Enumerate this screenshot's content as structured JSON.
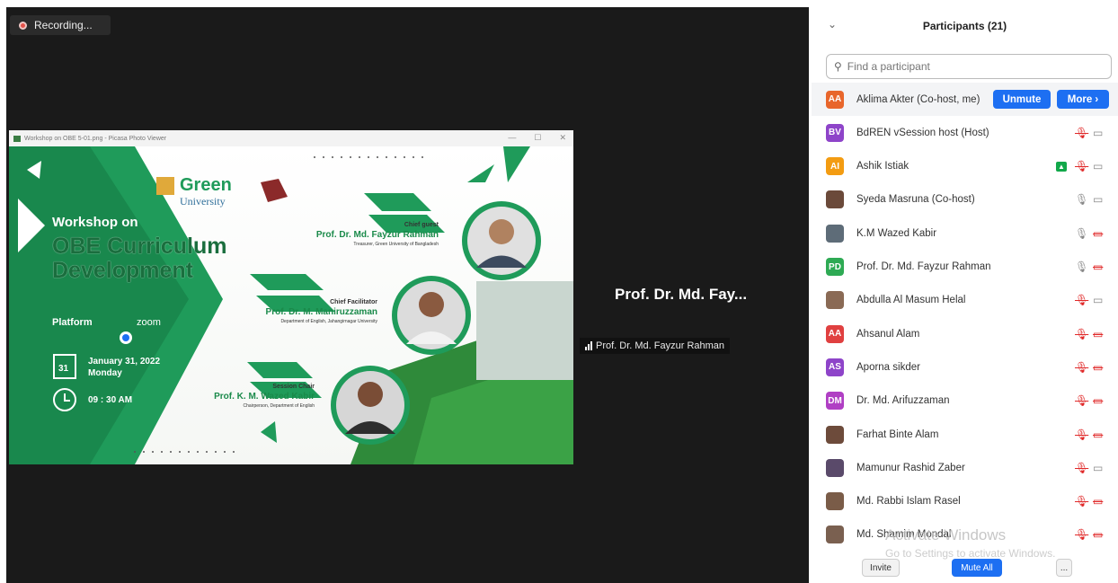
{
  "meeting": {
    "recording_label": "Recording...",
    "active_speaker_name": "Prof. Dr. Md. Fay...",
    "active_speaker_tag": "Prof. Dr. Md. Fayzur Rahman"
  },
  "share_window": {
    "title": "Workshop on OBE 5-01.png - Picasa Photo Viewer",
    "poster": {
      "university_name_1": "Green",
      "university_name_2": "University",
      "workshop_on": "Workshop on",
      "title_line1": "OBE Curriculum",
      "title_line2": "Development",
      "platform_label": "Platform",
      "platform_name": "zoom",
      "date_day": "31",
      "date_text": "January 31, 2022",
      "weekday": "Monday",
      "time": "09 : 30 AM",
      "chief_guest_label": "Chief guest",
      "chief_guest_name": "Prof. Dr. Md. Fayzur Rahman",
      "chief_guest_role": "Treasurer, Green University of Bangladesh",
      "facilitator_label": "Chief Facilitator",
      "facilitator_name": "Prof. Dr. M. Maniruzzaman",
      "facilitator_role": "Department of English, Jahangirnagar University",
      "chair_label": "Session Chair",
      "chair_name": "Prof. K. M. Wazed Kabir",
      "chair_role": "Chairperson, Department of English"
    }
  },
  "participants_panel": {
    "title": "Participants (21)",
    "search_placeholder": "Find a participant",
    "unmute_label": "Unmute",
    "more_label": "More ›",
    "items": [
      {
        "initials": "AA",
        "color": "#e8662b",
        "name": "Aklima Akter (Co-host, me)",
        "mic": "",
        "video": ""
      },
      {
        "initials": "BV",
        "color": "#8e44c9",
        "name": "BdREN vSession host (Host)",
        "mic": "off",
        "video": "on"
      },
      {
        "initials": "AI",
        "color": "#f39c12",
        "name": "Ashik Istiak",
        "mic": "off",
        "video": "on",
        "sharing": true
      },
      {
        "initials": "",
        "color": "#6b4a3a",
        "name": "Syeda Masruna (Co-host)",
        "mic": "on",
        "video": "on",
        "photo": true
      },
      {
        "initials": "",
        "color": "#5e6c78",
        "name": "K.M Wazed Kabir",
        "mic": "on",
        "video": "off",
        "photo": true
      },
      {
        "initials": "PD",
        "color": "#2eaa54",
        "name": "Prof. Dr. Md. Fayzur Rahman",
        "mic": "on",
        "video": "off"
      },
      {
        "initials": "",
        "color": "#8a6a55",
        "name": "Abdulla Al Masum Helal",
        "mic": "off",
        "video": "on",
        "photo": true
      },
      {
        "initials": "AA",
        "color": "#e04040",
        "name": "Ahsanul Alam",
        "mic": "off",
        "video": "off"
      },
      {
        "initials": "AS",
        "color": "#8e44c9",
        "name": "Aporna sikder",
        "mic": "off",
        "video": "off"
      },
      {
        "initials": "DM",
        "color": "#b03fc4",
        "name": "Dr. Md. Arifuzzaman",
        "mic": "off",
        "video": "off"
      },
      {
        "initials": "",
        "color": "#6d4b3b",
        "name": "Farhat Binte Alam",
        "mic": "off",
        "video": "off",
        "photo": true
      },
      {
        "initials": "",
        "color": "#5a4a6a",
        "name": "Mamunur Rashid Zaber",
        "mic": "off",
        "video": "on",
        "photo": true
      },
      {
        "initials": "",
        "color": "#7a5c48",
        "name": "Md. Rabbi Islam Rasel",
        "mic": "off",
        "video": "off",
        "photo": true
      },
      {
        "initials": "",
        "color": "#7a6050",
        "name": "Md. Shamim Mondal",
        "mic": "off",
        "video": "off",
        "photo": true
      }
    ],
    "footer": {
      "invite": "Invite",
      "mute_all": "Mute All",
      "more": "..."
    }
  },
  "watermark": {
    "line1": "Activate Windows",
    "line2": "Go to Settings to activate Windows."
  }
}
